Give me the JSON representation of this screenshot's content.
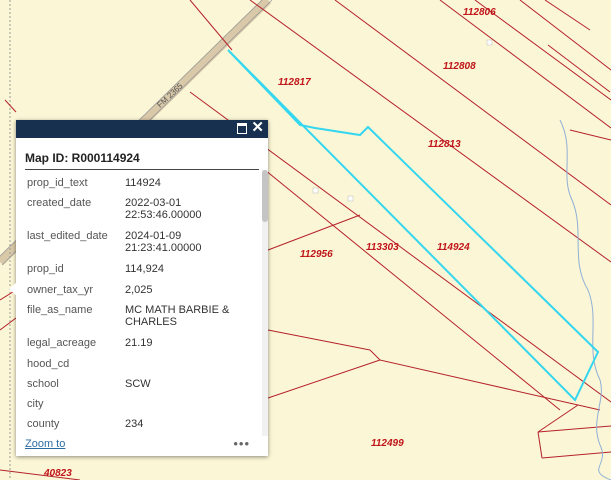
{
  "map": {
    "road_label": "FM 2365",
    "parcel_labels": [
      {
        "id": "lbl-112806",
        "text": "112806"
      },
      {
        "id": "lbl-112808",
        "text": "112808"
      },
      {
        "id": "lbl-112817",
        "text": "112817"
      },
      {
        "id": "lbl-112813",
        "text": "112813"
      },
      {
        "id": "lbl-113303",
        "text": "113303"
      },
      {
        "id": "lbl-114924",
        "text": "114924"
      },
      {
        "id": "lbl-112956",
        "text": "112956"
      },
      {
        "id": "lbl-112499",
        "text": "112499"
      },
      {
        "id": "lbl-40823",
        "text": "40823"
      }
    ],
    "colors": {
      "background": "#fbf6d5",
      "parcel_line": "#b5222b",
      "highlight": "#35d6ef",
      "creek": "#8fb0d8",
      "popup_header": "#17304f"
    }
  },
  "popup": {
    "title": "Map ID: R000114924",
    "attributes": [
      {
        "key": "prop_id_text",
        "value": "114924"
      },
      {
        "key": "created_date",
        "value": "2022-03-01\n22:53:46.00000"
      },
      {
        "key": "last_edited_date",
        "value": "2024-01-09\n21:23:41.00000"
      },
      {
        "key": "prop_id",
        "value": "114,924"
      },
      {
        "key": "owner_tax_yr",
        "value": "2,025"
      },
      {
        "key": "file_as_name",
        "value": "MC MATH BARBIE &\nCHARLES"
      },
      {
        "key": "legal_acreage",
        "value": "21.19"
      },
      {
        "key": "hood_cd",
        "value": ""
      },
      {
        "key": "school",
        "value": "SCW"
      },
      {
        "key": "city",
        "value": ""
      },
      {
        "key": "county",
        "value": "234"
      }
    ],
    "zoom_label": "Zoom to",
    "more_label": "•••",
    "maximize_icon": "maximize-icon",
    "close_icon": "close-icon",
    "close_glyph": "✕"
  }
}
